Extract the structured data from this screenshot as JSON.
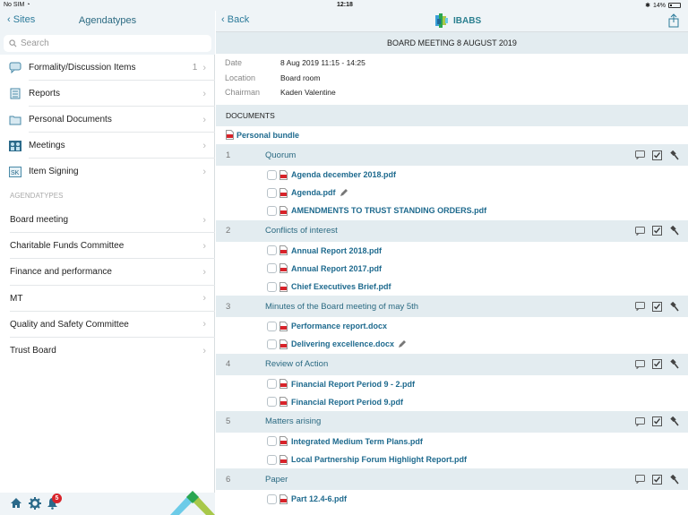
{
  "status": {
    "carrier": "No SIM",
    "time": "12:18",
    "battery": "14%"
  },
  "left": {
    "back_label": "Sites",
    "title": "Agendatypes",
    "search_placeholder": "Search",
    "menu": [
      {
        "label": "Formality/Discussion Items",
        "count": "1",
        "icon": "chat-icon"
      },
      {
        "label": "Reports",
        "count": "",
        "icon": "report-icon"
      },
      {
        "label": "Personal Documents",
        "count": "",
        "icon": "folder-icon"
      },
      {
        "label": "Meetings",
        "count": "",
        "icon": "meetings-icon"
      },
      {
        "label": "Item Signing",
        "count": "",
        "icon": "signing-icon"
      }
    ],
    "section_label": "AGENDATYPES",
    "agendatypes": [
      {
        "label": "Board meeting"
      },
      {
        "label": "Charitable Funds Committee"
      },
      {
        "label": "Finance and performance"
      },
      {
        "label": "MT"
      },
      {
        "label": "Quality and Safety Committee"
      },
      {
        "label": "Trust Board"
      }
    ],
    "notification_count": "5"
  },
  "right": {
    "back_label": "Back",
    "brand": "IBABS",
    "meeting_title": "BOARD MEETING 8 AUGUST 2019",
    "info": [
      {
        "key": "Date",
        "value": "8 Aug 2019 11:15 - 14:25"
      },
      {
        "key": "Location",
        "value": "Board room"
      },
      {
        "key": "Chairman",
        "value": "Kaden Valentine"
      }
    ],
    "documents_header": "DOCUMENTS",
    "personal_bundle": "Personal bundle",
    "items": [
      {
        "num": "1",
        "title": "Quorum",
        "docs": [
          {
            "name": "Agenda december 2018.pdf",
            "edited": false
          },
          {
            "name": "Agenda.pdf",
            "edited": true
          },
          {
            "name": "AMENDMENTS TO TRUST STANDING ORDERS.pdf",
            "edited": false
          }
        ]
      },
      {
        "num": "2",
        "title": "Conflicts of interest",
        "docs": [
          {
            "name": "Annual Report 2018.pdf",
            "edited": false
          },
          {
            "name": "Annual Report 2017.pdf",
            "edited": false
          },
          {
            "name": "Chief Executives Brief.pdf",
            "edited": false
          }
        ]
      },
      {
        "num": "3",
        "title": "Minutes of the Board meeting of may 5th",
        "docs": [
          {
            "name": "Performance report.docx",
            "edited": false
          },
          {
            "name": "Delivering excellence.docx",
            "edited": true
          }
        ]
      },
      {
        "num": "4",
        "title": "Review of Action",
        "docs": [
          {
            "name": "Financial Report Period 9 - 2.pdf",
            "edited": false
          },
          {
            "name": "Financial Report Period 9.pdf",
            "edited": false
          }
        ]
      },
      {
        "num": "5",
        "title": "Matters arising",
        "docs": [
          {
            "name": "Integrated Medium Term Plans.pdf",
            "edited": false
          },
          {
            "name": "Local Partnership Forum Highlight Report.pdf",
            "edited": false
          }
        ]
      },
      {
        "num": "6",
        "title": "Paper",
        "docs": [
          {
            "name": "Part 12.4-6.pdf",
            "edited": false
          }
        ]
      }
    ]
  }
}
